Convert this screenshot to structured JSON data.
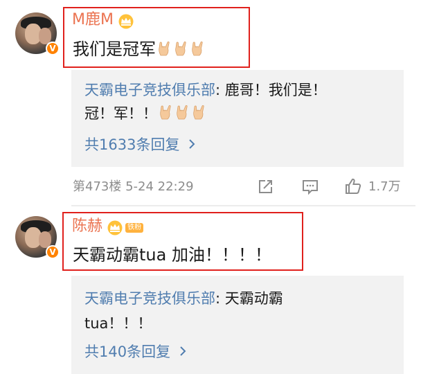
{
  "comment1": {
    "username": "M鹿M",
    "text": "我们是冠军",
    "reply": {
      "author": "天霸电子竞技俱乐部",
      "text_line1": ": 鹿哥！我们是！",
      "text_line2": "冠！军！！"
    },
    "replies_count": "共1633条回复",
    "floor_time": "第473楼 5-24 22:29",
    "likes": "1.7万"
  },
  "comment2": {
    "username": "陈赫",
    "fan_badge": "铁粉",
    "text": "天霸动霸tua 加油！！！！",
    "reply": {
      "author": "天霸电子竞技俱乐部",
      "text_line1": ": 天霸动霸",
      "text_line2": "tua！！！"
    },
    "replies_count": "共140条回复"
  },
  "verified_badge": "V",
  "icons": [
    "share-icon",
    "comment-icon",
    "like-icon",
    "chevron-right-icon",
    "crown-icon",
    "rock-hand-emoji"
  ],
  "colors": {
    "username": "#eb7350",
    "link": "#507daf",
    "highlight_box": "#e0201c",
    "reply_bg": "#f2f2f2",
    "verified": "#ff8200"
  }
}
